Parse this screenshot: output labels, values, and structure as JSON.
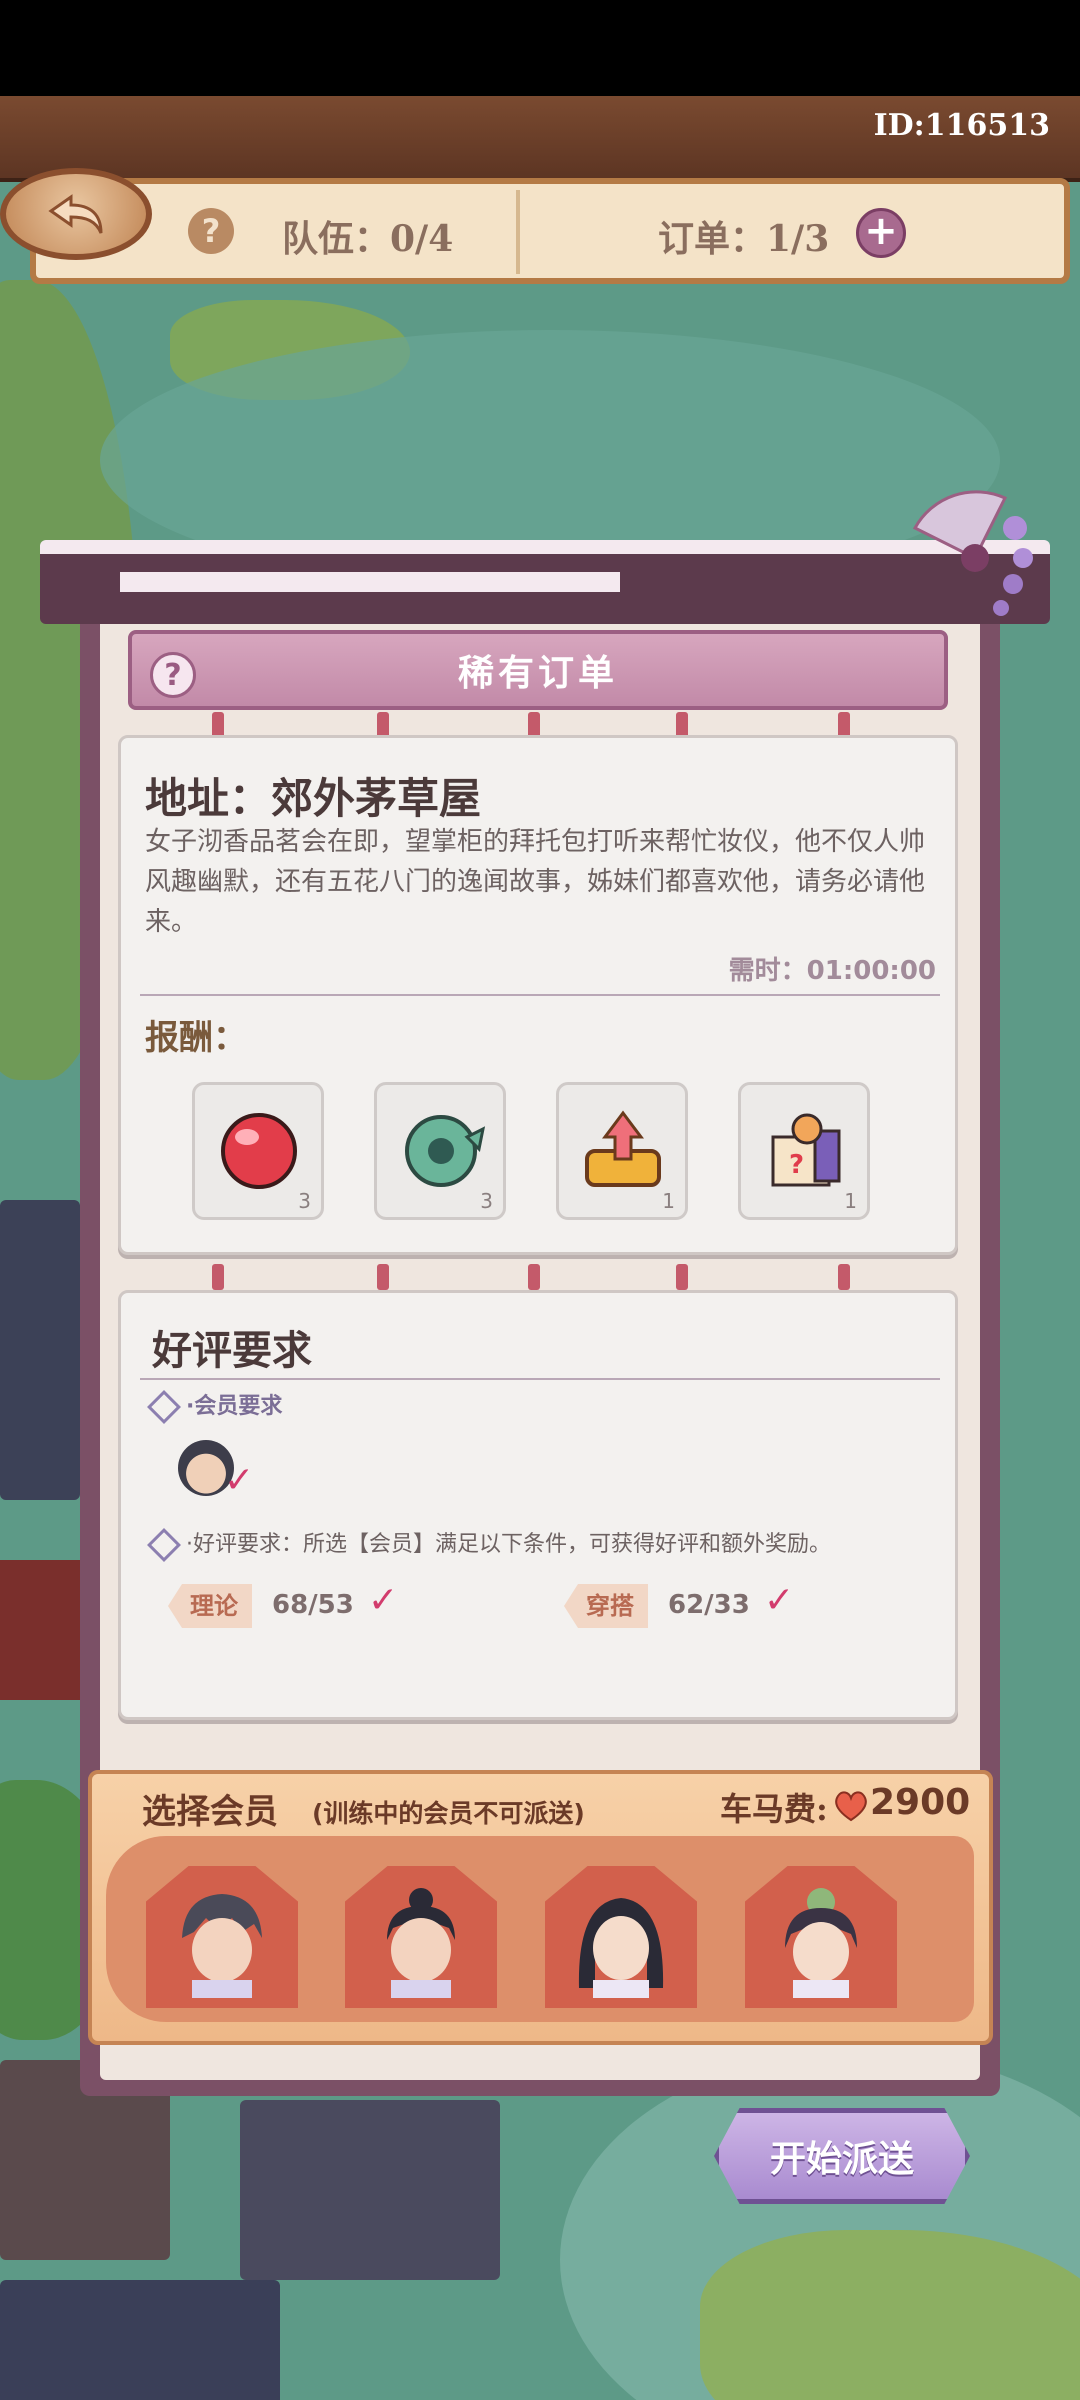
{
  "header": {
    "player_id": "ID:116513",
    "team_label": "队伍：0/4",
    "order_label": "订单：1/3"
  },
  "order": {
    "banner_title": "稀有订单",
    "address_title": "地址：郊外茅草屋",
    "description": "女子沏香品茗会在即，望掌柜的拜托包打听来帮忙妆仪，他不仅人帅风趣幽默，还有五花八门的逸闻故事，姊妹们都喜欢他，请务必请他来。",
    "time_required": "需时：01:00:00",
    "rewards_title": "报酬：",
    "rewards": [
      {
        "icon": "red-gem-icon",
        "qty": "3"
      },
      {
        "icon": "green-jade-icon",
        "qty": "3"
      },
      {
        "icon": "upgrade-chest-icon",
        "qty": "1"
      },
      {
        "icon": "mystery-box-icon",
        "qty": "1"
      }
    ]
  },
  "review": {
    "title": "好评要求",
    "member_requirement": "·会员要求",
    "good_review_requirement": "·好评要求：所选【会员】满足以下条件，可获得好评和额外奖励。",
    "stats": [
      {
        "label": "理论",
        "value": "68/53"
      },
      {
        "label": "穿搭",
        "value": "62/33"
      }
    ]
  },
  "selection": {
    "title": "选择会员",
    "note": "(训练中的会员不可派送)",
    "fee_label": "车马费:",
    "fee_value": "2900"
  },
  "actions": {
    "start_label": "开始派送"
  },
  "colors": {
    "accent_pink": "#c28aa8",
    "check_red": "#d23c6d",
    "panel_orange": "#eeb888"
  }
}
